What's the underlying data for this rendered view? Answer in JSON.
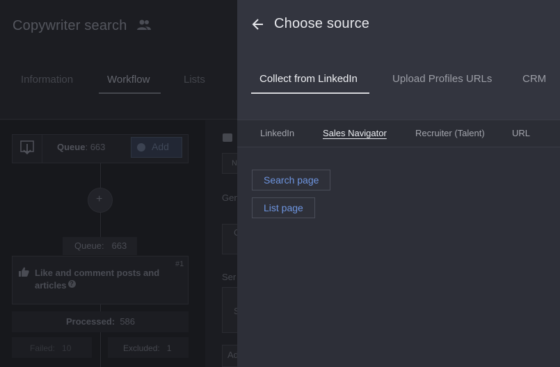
{
  "background": {
    "title": "Copywriter search",
    "tabs": [
      {
        "label": "Information"
      },
      {
        "label": "Workflow"
      },
      {
        "label": "Lists"
      }
    ],
    "queue": {
      "label": "Queue",
      "count": ": 663"
    },
    "add_label": "Add",
    "queue2": {
      "label": "Queue:",
      "count": "663"
    },
    "step": {
      "num": "#1",
      "text": "Like and comment posts and articles"
    },
    "processed": {
      "label": "Processed:",
      "count": "586"
    },
    "failed": {
      "label": "Failed:",
      "count": "10"
    },
    "excluded": {
      "label": "Excluded:",
      "count": "1"
    },
    "right_fragments": {
      "gen": "Gen",
      "ser": "Ser",
      "ad": "Ad",
      "n": "N",
      "c": "C",
      "s": "S"
    }
  },
  "panel": {
    "title": "Choose source",
    "tabs": [
      {
        "label": "Collect from LinkedIn",
        "active": true
      },
      {
        "label": "Upload Profiles URLs",
        "active": false
      },
      {
        "label": "CRM",
        "active": false
      }
    ],
    "subtabs": [
      {
        "label": "LinkedIn",
        "active": false
      },
      {
        "label": "Sales Navigator",
        "active": true
      },
      {
        "label": "Recruiter (Talent)",
        "active": false
      },
      {
        "label": "URL",
        "active": false
      }
    ],
    "buttons": [
      {
        "label": "Search page"
      },
      {
        "label": "List page"
      }
    ]
  },
  "colors": {
    "accent_link": "#6e95e0",
    "panel_bg": "#2d2f38",
    "panel_header_bg": "#33353f"
  }
}
